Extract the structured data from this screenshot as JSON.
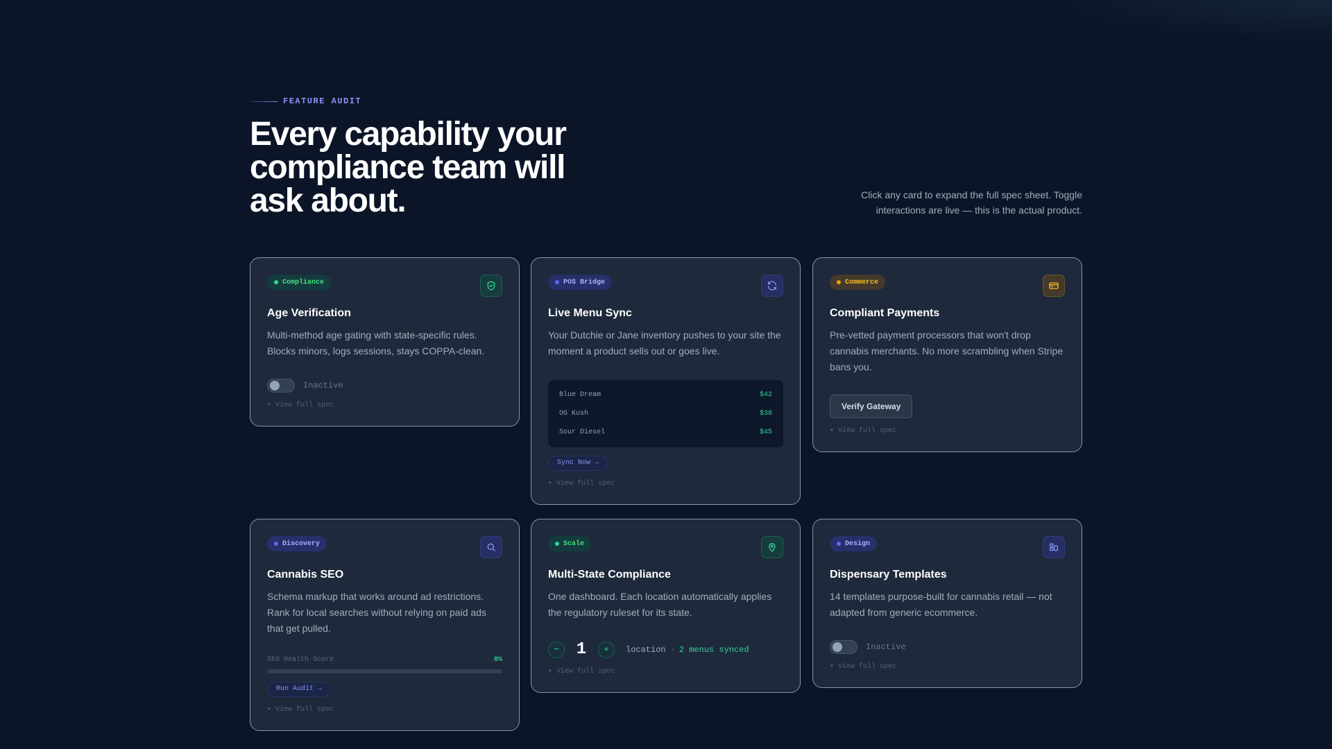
{
  "header": {
    "eyebrow": "FEATURE AUDIT",
    "headline": "Every capability your compliance team will ask about.",
    "intro": "Click any card to expand the full spec sheet. Toggle interactions are live — this is the actual product."
  },
  "colors": {
    "background": "#0b1527",
    "card": "#1e293b",
    "accent_green": "#34d399",
    "accent_indigo": "#818cf8",
    "accent_amber": "#fbbf24"
  },
  "cards": [
    {
      "badge": "Compliance",
      "icon": "shield-icon",
      "title": "Age Verification",
      "desc": "Multi-method age gating with state-specific rules. Blocks minors, logs sessions, stays COPPA-clean.",
      "toggle_label": "Inactive",
      "toggle_on": false,
      "spec": "▾ View full spec"
    },
    {
      "badge": "POS Bridge",
      "icon": "refresh-icon",
      "title": "Live Menu Sync",
      "desc": "Your Dutchie or Jane inventory pushes to your site the moment a product sells out or goes live.",
      "menu": [
        {
          "name": "Blue Dream",
          "price": "$42"
        },
        {
          "name": "OG Kush",
          "price": "$38"
        },
        {
          "name": "Sour Diesel",
          "price": "$45"
        }
      ],
      "button": "Sync Now →",
      "spec": "▾ View full spec"
    },
    {
      "badge": "Commerce",
      "icon": "credit-card-icon",
      "title": "Compliant Payments",
      "desc": "Pre-vetted payment processors that won't drop cannabis merchants. No more scrambling when Stripe bans you.",
      "button": "Verify Gateway",
      "spec": "▾ View full spec"
    },
    {
      "badge": "Discovery",
      "icon": "search-icon",
      "title": "Cannabis SEO",
      "desc": "Schema markup that works around ad restrictions. Rank for local searches without relying on paid ads that get pulled.",
      "score_label": "SEO Health Score",
      "score_value": "0%",
      "score_fraction": 0,
      "button": "Run Audit →",
      "spec": "▾ View full spec"
    },
    {
      "badge": "Scale",
      "icon": "map-pin-icon",
      "title": "Multi-State Compliance",
      "desc": "One dashboard. Each location automatically applies the regulatory ruleset for its state.",
      "minus": "−",
      "plus": "+",
      "count": "1",
      "unit": "location",
      "separator": "·",
      "synced": "2 menus synced",
      "spec": "▾ View full spec"
    },
    {
      "badge": "Design",
      "icon": "layout-icon",
      "title": "Dispensary Templates",
      "desc": "14 templates purpose-built for cannabis retail — not adapted from generic ecommerce.",
      "toggle_label": "Inactive",
      "toggle_on": false,
      "spec": "▾ View full spec"
    }
  ]
}
